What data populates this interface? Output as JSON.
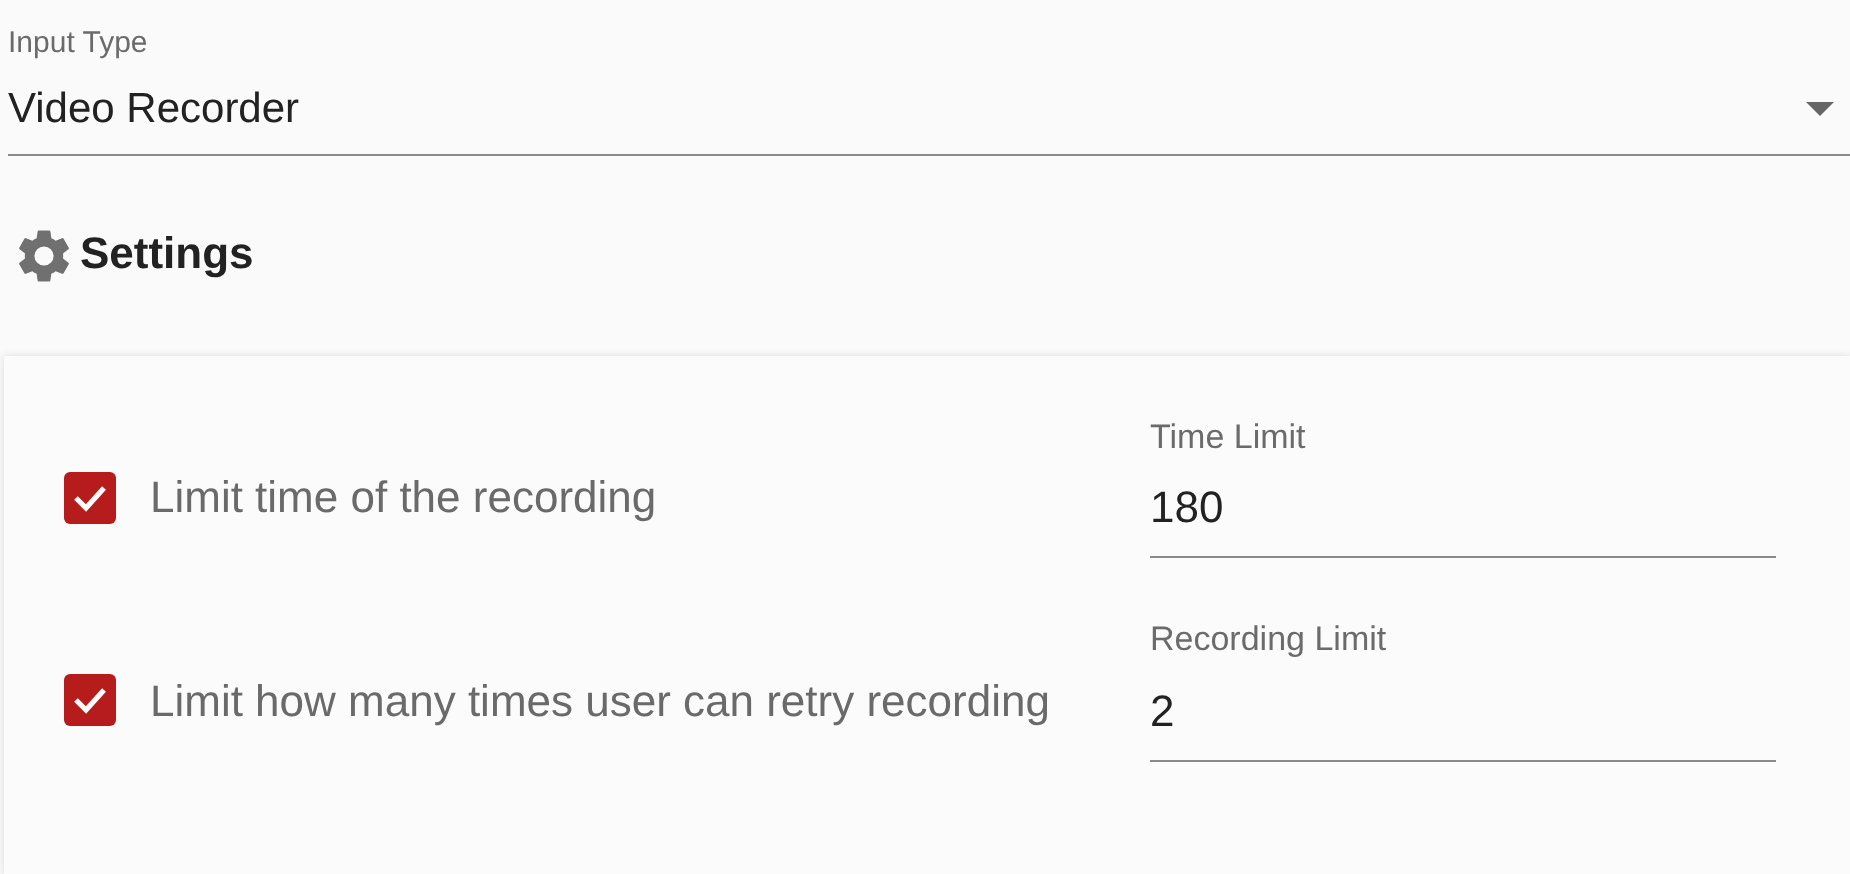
{
  "input_type": {
    "label": "Input Type",
    "value": "Video Recorder"
  },
  "settings": {
    "title": "Settings",
    "options": [
      {
        "label": "Limit time of the recording",
        "checked": true,
        "field": {
          "label": "Time Limit",
          "value": "180"
        }
      },
      {
        "label": "Limit how many times user can retry recording",
        "checked": true,
        "field": {
          "label": "Recording Limit",
          "value": "2"
        }
      }
    ]
  }
}
